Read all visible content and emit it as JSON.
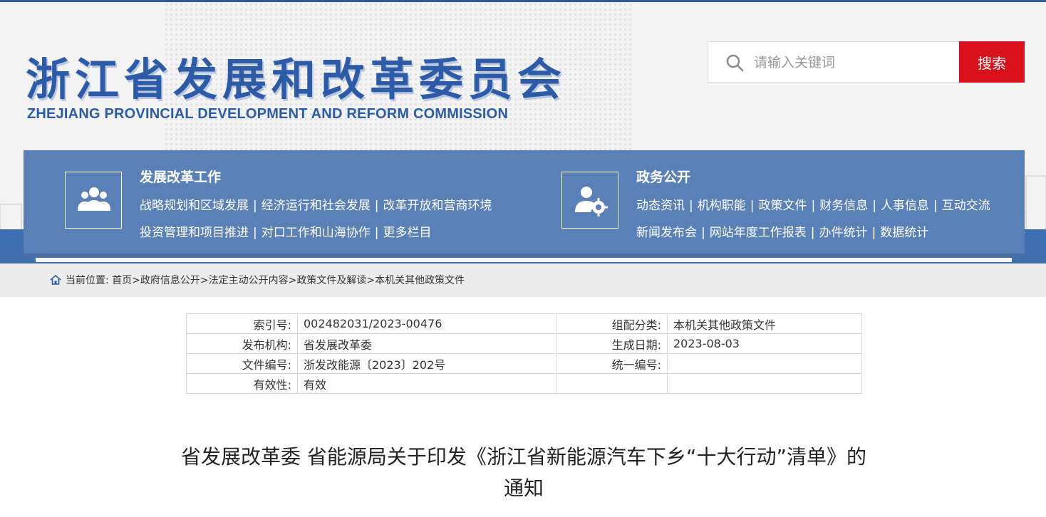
{
  "header": {
    "title_cn": "浙江省发展和改革委员会",
    "title_en": "ZHEJIANG PROVINCIAL DEVELOPMENT AND REFORM COMMISSION"
  },
  "search": {
    "placeholder": "请输入关键词",
    "button_label": "搜索"
  },
  "nav": {
    "left": {
      "heading": "发展改革工作",
      "icon": "people-group-icon",
      "row1": [
        "战略规划和区域发展",
        "经济运行和社会发展",
        "改革开放和营商环境"
      ],
      "row2": [
        "投资管理和项目推进",
        "对口工作和山海协作",
        "更多栏目"
      ]
    },
    "right": {
      "heading": "政务公开",
      "icon": "user-gear-icon",
      "row1": [
        "动态资讯",
        "机构职能",
        "政策文件",
        "财务信息",
        "人事信息",
        "互动交流"
      ],
      "row2": [
        "新闻发布会",
        "网站年度工作报表",
        "办件统计",
        "数据统计"
      ]
    },
    "separator": "|"
  },
  "breadcrumb": {
    "prefix": "当前位置:",
    "items": [
      "首页",
      "政府信息公开",
      "法定主动公开内容",
      "政策文件及解读",
      "本机关其他政策文件"
    ],
    "separator": ">"
  },
  "meta": {
    "rows": [
      {
        "k1": "索引号:",
        "v1": "002482031/2023-00476",
        "k2": "组配分类:",
        "v2": "本机关其他政策文件"
      },
      {
        "k1": "发布机构:",
        "v1": "省发展改革委",
        "k2": "生成日期:",
        "v2": "2023-08-03"
      },
      {
        "k1": "文件编号:",
        "v1": "浙发改能源〔2023〕202号",
        "k2": "统一编号:",
        "v2": ""
      },
      {
        "k1": "有效性:",
        "v1": "有效",
        "k2": "",
        "v2": ""
      }
    ]
  },
  "document": {
    "title_line1": "省发展改革委 省能源局关于印发《浙江省新能源汽车下乡“十大行动”清单》的",
    "title_line2": "通知"
  },
  "colors": {
    "brand_blue": "#2d5ba7",
    "nav_panel": "#5a80b8",
    "search_button": "#d8111c"
  }
}
